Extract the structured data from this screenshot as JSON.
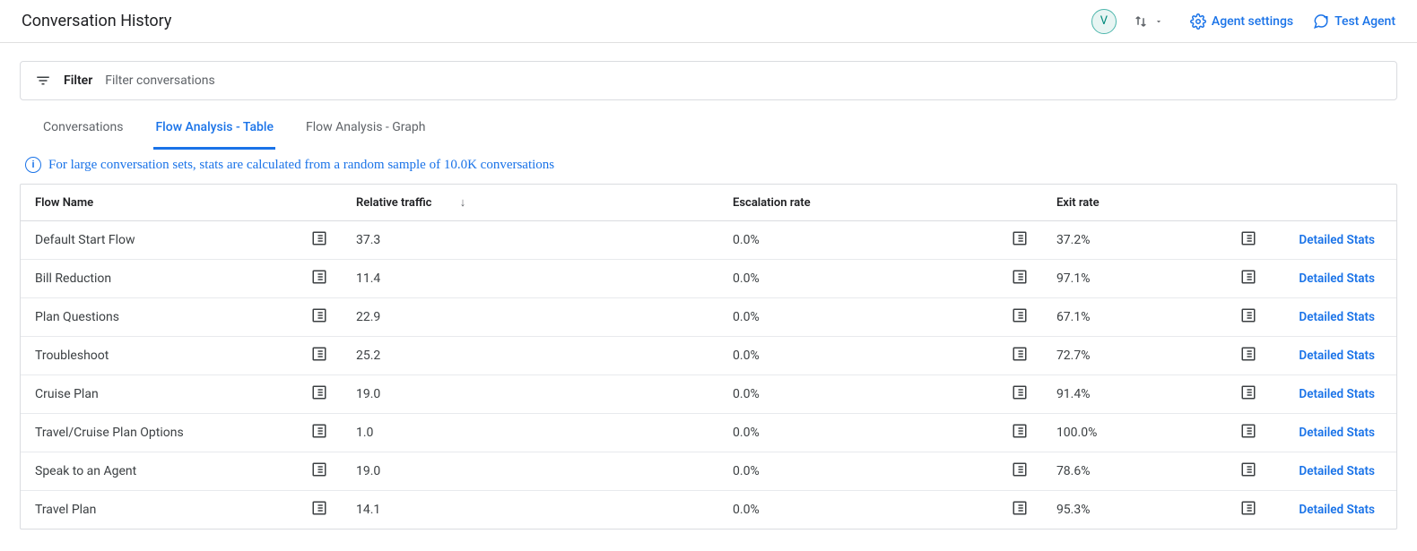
{
  "header": {
    "title": "Conversation History",
    "avatar_initial": "V",
    "agent_settings_label": "Agent settings",
    "test_agent_label": "Test Agent"
  },
  "filter": {
    "label": "Filter",
    "placeholder": "Filter conversations"
  },
  "tabs": {
    "conversations": "Conversations",
    "flow_table": "Flow Analysis - Table",
    "flow_graph": "Flow Analysis - Graph"
  },
  "info_banner": "For large conversation sets, stats are calculated from a random sample of 10.0K conversations",
  "table": {
    "headers": {
      "flow_name": "Flow Name",
      "relative_traffic": "Relative traffic",
      "escalation_rate": "Escalation rate",
      "exit_rate": "Exit rate"
    },
    "detailed_stats_label": "Detailed Stats",
    "rows": [
      {
        "name": "Default Start Flow",
        "traffic": "37.3",
        "escalation": "0.0%",
        "exit": "37.2%"
      },
      {
        "name": "Bill Reduction",
        "traffic": "11.4",
        "escalation": "0.0%",
        "exit": "97.1%"
      },
      {
        "name": "Plan Questions",
        "traffic": "22.9",
        "escalation": "0.0%",
        "exit": "67.1%"
      },
      {
        "name": "Troubleshoot",
        "traffic": "25.2",
        "escalation": "0.0%",
        "exit": "72.7%"
      },
      {
        "name": "Cruise Plan",
        "traffic": "19.0",
        "escalation": "0.0%",
        "exit": "91.4%"
      },
      {
        "name": "Travel/Cruise Plan Options",
        "traffic": "1.0",
        "escalation": "0.0%",
        "exit": "100.0%"
      },
      {
        "name": "Speak to an Agent",
        "traffic": "19.0",
        "escalation": "0.0%",
        "exit": "78.6%"
      },
      {
        "name": "Travel Plan",
        "traffic": "14.1",
        "escalation": "0.0%",
        "exit": "95.3%"
      }
    ]
  }
}
